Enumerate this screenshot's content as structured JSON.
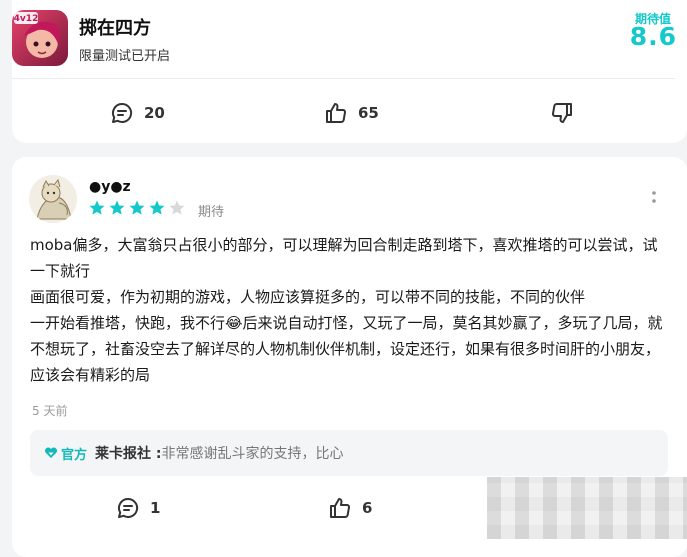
{
  "game": {
    "title": "掷在四方",
    "subtitle": "限量测试已开启",
    "icon_text": "4v12",
    "expect_label": "期待值",
    "expect_score": "8.6",
    "actions": {
      "comments_icon": "comment-icon",
      "comments_count": "20",
      "likes_icon": "thumbs-up-icon",
      "likes_count": "65",
      "dislike_icon": "thumbs-down-icon"
    }
  },
  "review": {
    "username": "●y●z",
    "rating": 4,
    "rating_max": 5,
    "rating_label": "期待",
    "paragraphs": [
      "moba偏多，大富翁只占很小的部分，可以理解为回合制走路到塔下，喜欢推塔的可以尝试，试一下就行",
      "画面很可爱，作为初期的游戏，人物应该算挺多的，可以带不同的技能，不同的伙伴",
      "一开始看推塔，快跑，我不行😂后来说自动打怪，又玩了一局，莫名其妙赢了，多玩了几局，就不想玩了，社畜没空去了解详尽的人物机制伙伴机制，设定还行，如果有很多时间肝的小朋友，应该会有精彩的局"
    ],
    "time": "5 天前",
    "reply": {
      "badge": "官方",
      "developer": "莱卡报社 :",
      "text": " 非常感谢乱斗家的支持，比心"
    },
    "actions": {
      "comments_count": "1",
      "likes_count": "6"
    }
  },
  "colors": {
    "accent": "#14c9c9",
    "star_on": "#14c9c9",
    "star_off": "#d8d8d8"
  }
}
